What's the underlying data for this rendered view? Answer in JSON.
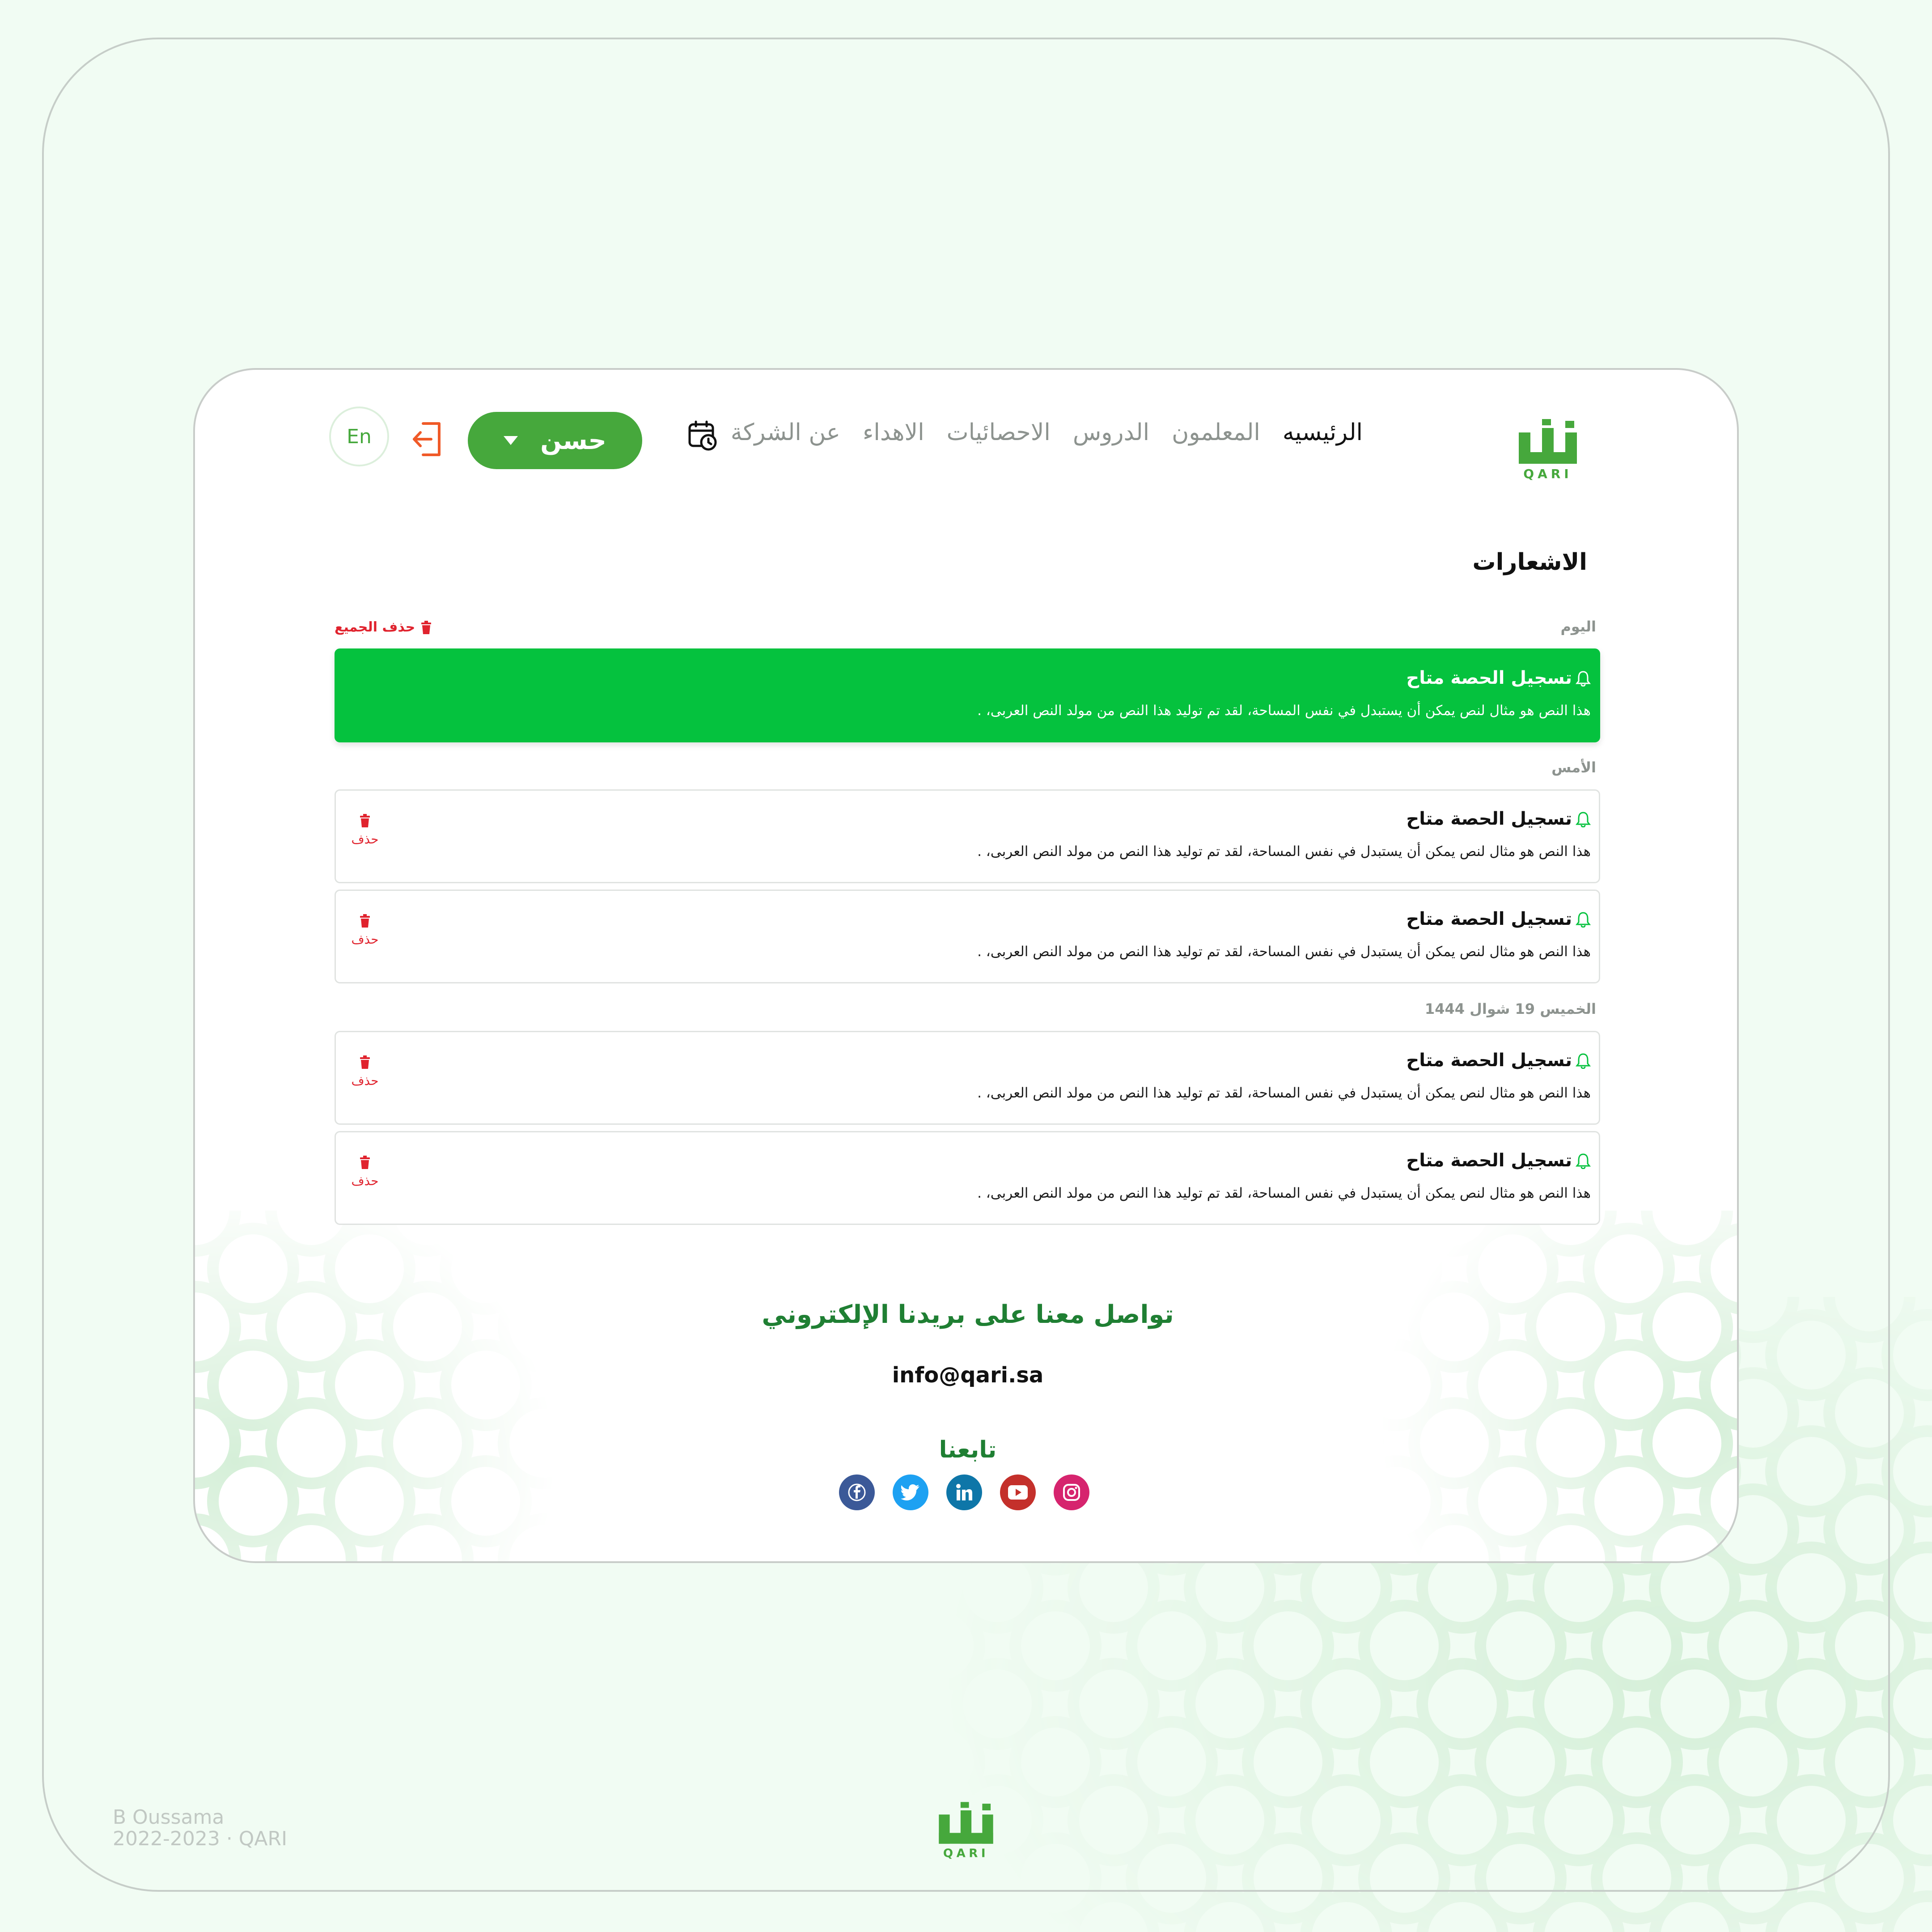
{
  "brand": {
    "name": "QARI",
    "logo_text": "قارئ",
    "logo_latin": "QARI",
    "color": "#46a83c",
    "dark_green": "#1f7f33"
  },
  "nav": {
    "links": [
      "الرئيسيه",
      "المعلمون",
      "الدروس",
      "الاحصائيات",
      "الاهداء",
      "عن الشركة"
    ],
    "user_name": "حسن",
    "lang": "En",
    "icons": {
      "calendar": "calendar-clock-icon",
      "logout": "logout-icon",
      "caret": "chevron-down-icon"
    }
  },
  "page": {
    "title": "الاشعارات",
    "delete_all_label": "حذف الجميع"
  },
  "sections": [
    {
      "label": "اليوم",
      "items": [
        {
          "title": "تسجيل الحصة متاح",
          "body": "هذا النص هو مثال لنص يمكن أن يستبدل في نفس المساحة، لقد تم توليد هذا النص من مولد النص العربى، .",
          "active": true
        }
      ]
    },
    {
      "label": "الأمس",
      "items": [
        {
          "title": "تسجيل الحصة متاح",
          "body": "هذا النص هو مثال لنص يمكن أن يستبدل في نفس المساحة، لقد تم توليد هذا النص من مولد النص العربى، .",
          "delete_label": "حذف"
        },
        {
          "title": "تسجيل الحصة متاح",
          "body": "هذا النص هو مثال لنص يمكن أن يستبدل في نفس المساحة، لقد تم توليد هذا النص من مولد النص العربى، .",
          "delete_label": "حذف"
        }
      ]
    },
    {
      "label": "الخميس 19 شوال 1444",
      "items": [
        {
          "title": "تسجيل الحصة متاح",
          "body": "هذا النص هو مثال لنص يمكن أن يستبدل في نفس المساحة، لقد تم توليد هذا النص من مولد النص العربى، .",
          "delete_label": "حذف"
        },
        {
          "title": "تسجيل الحصة متاح",
          "body": "هذا النص هو مثال لنص يمكن أن يستبدل في نفس المساحة، لقد تم توليد هذا النص من مولد النص العربى، .",
          "delete_label": "حذف"
        }
      ]
    }
  ],
  "footer": {
    "contact_title": "تواصل معنا على بريدنا الإلكتروني",
    "email": "info@qari.sa",
    "follow_title": "تابعنا",
    "socials": [
      {
        "name": "facebook-icon",
        "color": "#3b5998"
      },
      {
        "name": "twitter-icon",
        "color": "#1da1f2"
      },
      {
        "name": "linkedin-icon",
        "color": "#0e76a8"
      },
      {
        "name": "youtube-icon",
        "color": "#c4302b"
      },
      {
        "name": "instagram-icon",
        "color": "#d6246e"
      }
    ]
  },
  "credit": {
    "author": "B Oussama",
    "years": "2022-2023 · QARI"
  },
  "colors": {
    "background": "#f1fcf3",
    "active_notification": "#05c23e",
    "delete_red": "#e0232e",
    "logout_orange": "#f05a28"
  }
}
